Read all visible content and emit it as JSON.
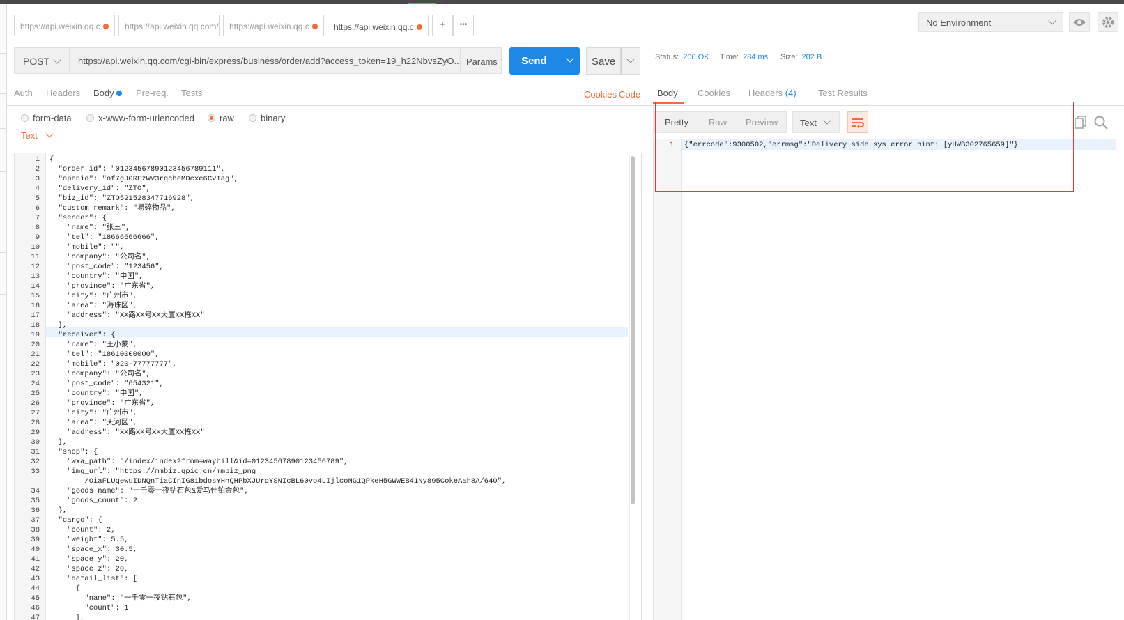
{
  "tabs": [
    {
      "label": "https://api.weixin.qq.c",
      "dirty": true
    },
    {
      "label": "https://api.weixin.qq.com/c",
      "dirty": false
    },
    {
      "label": "https://api.weixin.qq.c",
      "dirty": true
    },
    {
      "label": "https://api.weixin.qq.c",
      "dirty": true
    }
  ],
  "tab_actions": {
    "add": "+",
    "more": "•••"
  },
  "environment": {
    "selected": "No Environment"
  },
  "request": {
    "method": "POST",
    "url": "https://api.weixin.qq.com/cgi-bin/express/business/order/add?access_token=19_h22NbvsZyO...",
    "params_label": "Params",
    "send_label": "Send",
    "save_label": "Save"
  },
  "request_tabs": {
    "auth": "Auth",
    "headers": "Headers",
    "body": "Body",
    "prereq": "Pre-req.",
    "tests": "Tests",
    "cookies": "Cookies",
    "code": "Code"
  },
  "body_modes": {
    "form_data": "form-data",
    "urlencoded": "x-www-form-urlencoded",
    "raw": "raw",
    "binary": "binary",
    "selected": "raw"
  },
  "content_type": "Text",
  "code_lines": [
    "{",
    "  \"order_id\": \"01234567890123456789111\",",
    "  \"openid\": \"of7gJ0REzWV3rqcbeMDcxe6CvTag\",",
    "  \"delivery_id\": \"ZTO\",",
    "  \"biz_id\": \"ZTO521528347716928\",",
    "  \"custom_remark\": \"易碎物品\",",
    "  \"sender\": {",
    "    \"name\": \"张三\",",
    "    \"tel\": \"18666666666\",",
    "    \"mobile\": \"\",",
    "    \"company\": \"公司名\",",
    "    \"post_code\": \"123456\",",
    "    \"country\": \"中国\",",
    "    \"province\": \"广东省\",",
    "    \"city\": \"广州市\",",
    "    \"area\": \"海珠区\",",
    "    \"address\": \"XX路XX号XX大厦XX栋XX\"",
    "  },",
    "  \"receiver\": {",
    "    \"name\": \"王小蒙\",",
    "    \"tel\": \"18610000000\",",
    "    \"mobile\": \"020-77777777\",",
    "    \"company\": \"公司名\",",
    "    \"post_code\": \"654321\",",
    "    \"country\": \"中国\",",
    "    \"province\": \"广东省\",",
    "    \"city\": \"广州市\",",
    "    \"area\": \"天河区\",",
    "    \"address\": \"XX路XX号XX大厦XX栋XX\"",
    "  },",
    "  \"shop\": {",
    "    \"wxa_path\": \"/index/index?from=waybill&id=01234567890123456789\",",
    "    \"img_url\": \"https://mmbiz.qpic.cn/mmbiz_png\n        /OiaFLUqewuIDNQnTiaCInIG8ibdosYHhQHPbXJUrqYSNIcBL60vo4LIjlcoNG1QPkeH5GWWEB41Ny895CokeAah8A/640\",",
    "    \"goods_name\": \"一千零一夜钻石包&爱马仕铂金包\",",
    "    \"goods_count\": 2",
    "  },",
    "  \"cargo\": {",
    "    \"count\": 2,",
    "    \"weight\": 5.5,",
    "    \"space_x\": 30.5,",
    "    \"space_y\": 20,",
    "    \"space_z\": 20,",
    "    \"detail_list\": [",
    "      {",
    "        \"name\": \"一千零一夜钻石包\",",
    "        \"count\": 1",
    "      },"
  ],
  "response": {
    "status_label": "Status:",
    "status": "200 OK",
    "time_label": "Time:",
    "time": "284 ms",
    "size_label": "Size:",
    "size": "202 B",
    "tabs": {
      "body": "Body",
      "cookies": "Cookies",
      "headers": "Headers",
      "headers_count": "(4)",
      "tests": "Test Results"
    },
    "views": {
      "pretty": "Pretty",
      "raw": "Raw",
      "preview": "Preview"
    },
    "format": "Text",
    "line_no": "1",
    "body": "{\"errcode\":9300502,\"errmsg\":\"Delivery side sys error hint: [yHWB302765659]\"}"
  },
  "colors": {
    "accent": "#f26b3a",
    "primary": "#1e88e5",
    "annotation": "#e03a3a"
  }
}
